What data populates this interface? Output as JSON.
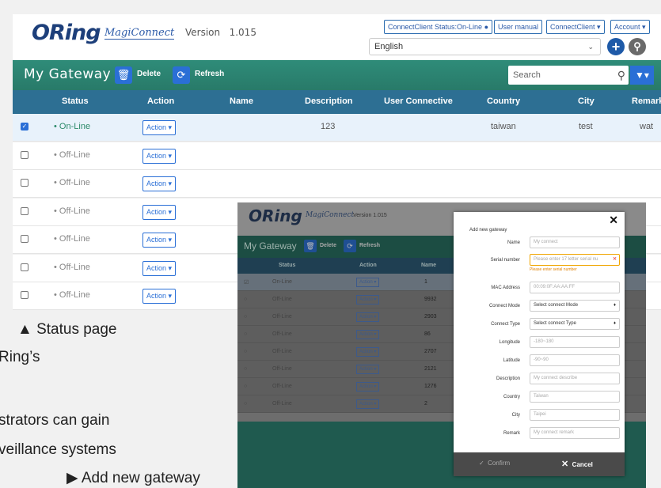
{
  "header": {
    "logo_main": "ORing",
    "logo_sub": "MagiConnect",
    "version_label": "Version",
    "version": "1.015",
    "status_button": "ConnectClient Status:On-Line ●",
    "manual_button": "User manual",
    "client_menu": "ConnectClient ▾",
    "account_menu": "Account ▾",
    "language": "English"
  },
  "toolbar": {
    "title": "My Gateway",
    "delete_label": "Delete",
    "refresh_label": "Refresh",
    "search_placeholder": "Search"
  },
  "table": {
    "columns": [
      "Status",
      "Action",
      "Name",
      "Description",
      "User Connective",
      "Country",
      "City",
      "Remark"
    ],
    "action_label": "Action ▾",
    "rows": [
      {
        "checked": true,
        "status": "On-Line",
        "description": "123",
        "country": "taiwan",
        "city": "test",
        "remark": "wat"
      },
      {
        "checked": false,
        "status": "Off-Line",
        "description": "",
        "country": "",
        "city": "",
        "remark": ""
      },
      {
        "checked": false,
        "status": "Off-Line",
        "description": "",
        "country": "",
        "city": "",
        "remark": ""
      },
      {
        "checked": false,
        "status": "Off-Line",
        "description": "",
        "country": "",
        "city": "",
        "remark": ""
      },
      {
        "checked": false,
        "status": "Off-Line",
        "description": "",
        "country": "",
        "city": "",
        "remark": ""
      },
      {
        "checked": false,
        "status": "Off-Line",
        "description": "",
        "country": "",
        "city": "",
        "remark": ""
      },
      {
        "checked": false,
        "status": "Off-Line",
        "description": "",
        "country": "",
        "city": "",
        "remark": ""
      }
    ]
  },
  "captions": {
    "status_page": "▲ Status page",
    "line1": "Ring’s",
    "line2": "strators can gain",
    "line3": "veillance systems",
    "add_gateway": "▶ Add new gateway"
  },
  "inset": {
    "logo_main": "ORing",
    "logo_sub": "MagiConnect",
    "version": "Version  1.015",
    "title": "My Gateway",
    "delete_label": "Delete",
    "refresh_label": "Refresh",
    "columns": [
      "Status",
      "Action",
      "Name"
    ],
    "row_names": [
      "1",
      "9932",
      "2903",
      "86",
      "2707",
      "2121",
      "1276",
      "2"
    ],
    "row_status": [
      "On-Line",
      "Off-Line",
      "Off-Line",
      "Off-Line",
      "Off-Line",
      "Off-Line",
      "Off-Line",
      "Off-Line"
    ]
  },
  "modal": {
    "title": "Add new gateway",
    "close": "✕",
    "fields": [
      {
        "label": "Name",
        "placeholder": "My connect"
      },
      {
        "label": "Serial number",
        "placeholder": "Please enter 17 letter serial nu"
      },
      {
        "label": "MAC Address",
        "placeholder": "00:09:0F:AA:AA:FF"
      },
      {
        "label": "Connect Mode",
        "placeholder": "Select connect Mode"
      },
      {
        "label": "Connect Type",
        "placeholder": "Select connect Type"
      },
      {
        "label": "Longitude",
        "placeholder": "-180~180"
      },
      {
        "label": "Latitude",
        "placeholder": "-90~90"
      },
      {
        "label": "Description",
        "placeholder": "My connect describe"
      },
      {
        "label": "Country",
        "placeholder": "Taiwan"
      },
      {
        "label": "City",
        "placeholder": "Taipei"
      },
      {
        "label": "Remark",
        "placeholder": "My connect remark"
      }
    ],
    "serial_warning": "Please enter serial number",
    "confirm_label": "Confirm",
    "cancel_label": "Cancel"
  }
}
